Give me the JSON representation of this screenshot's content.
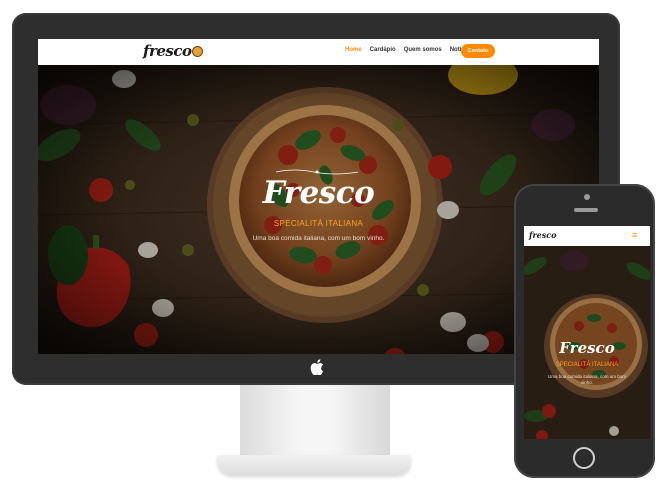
{
  "site": {
    "logo": "fresco",
    "nav": [
      {
        "label": "Home",
        "active": true
      },
      {
        "label": "Cardápio",
        "active": false
      },
      {
        "label": "Quem somos",
        "active": false
      },
      {
        "label": "Notícias",
        "active": false
      }
    ],
    "contact_label": "Contato",
    "hero": {
      "title": "Fresco",
      "subtitle": "SPECIALITÁ ITALIANA",
      "description": "Uma boa comida italiana, com um bom vinho."
    }
  },
  "mobile": {
    "logo": "fresco",
    "menu_icon": "hamburger-icon",
    "hero": {
      "title": "Fresco",
      "subtitle": "SPECIALITÁ ITALIANA",
      "description": "Uma boa comida italiana, com um bom vinho."
    }
  },
  "colors": {
    "accent": "#ff8a00",
    "subtitle": "#ffa21a",
    "device_frame": "#2e2e2e",
    "background": "#1b130c"
  },
  "icons": [
    "apple-icon",
    "pizza-logo-icon",
    "hamburger-icon",
    "home-button-icon"
  ]
}
